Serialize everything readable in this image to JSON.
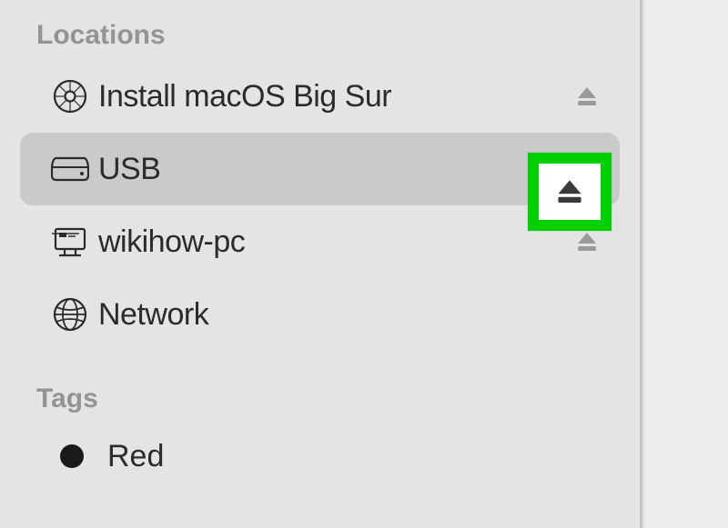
{
  "sidebar": {
    "sections": {
      "locations": {
        "header": "Locations",
        "items": [
          {
            "label": "Install macOS Big Sur",
            "icon": "optical-disk-icon",
            "ejectable": true,
            "selected": false
          },
          {
            "label": "USB",
            "icon": "external-drive-icon",
            "ejectable": true,
            "selected": true,
            "highlighted_eject": true
          },
          {
            "label": "wikihow-pc",
            "icon": "network-pc-icon",
            "ejectable": true,
            "selected": false
          },
          {
            "label": "Network",
            "icon": "globe-icon",
            "ejectable": false,
            "selected": false
          }
        ]
      },
      "tags": {
        "header": "Tags",
        "items": [
          {
            "label": "Red",
            "color": "#1a1a1a"
          }
        ]
      }
    }
  }
}
